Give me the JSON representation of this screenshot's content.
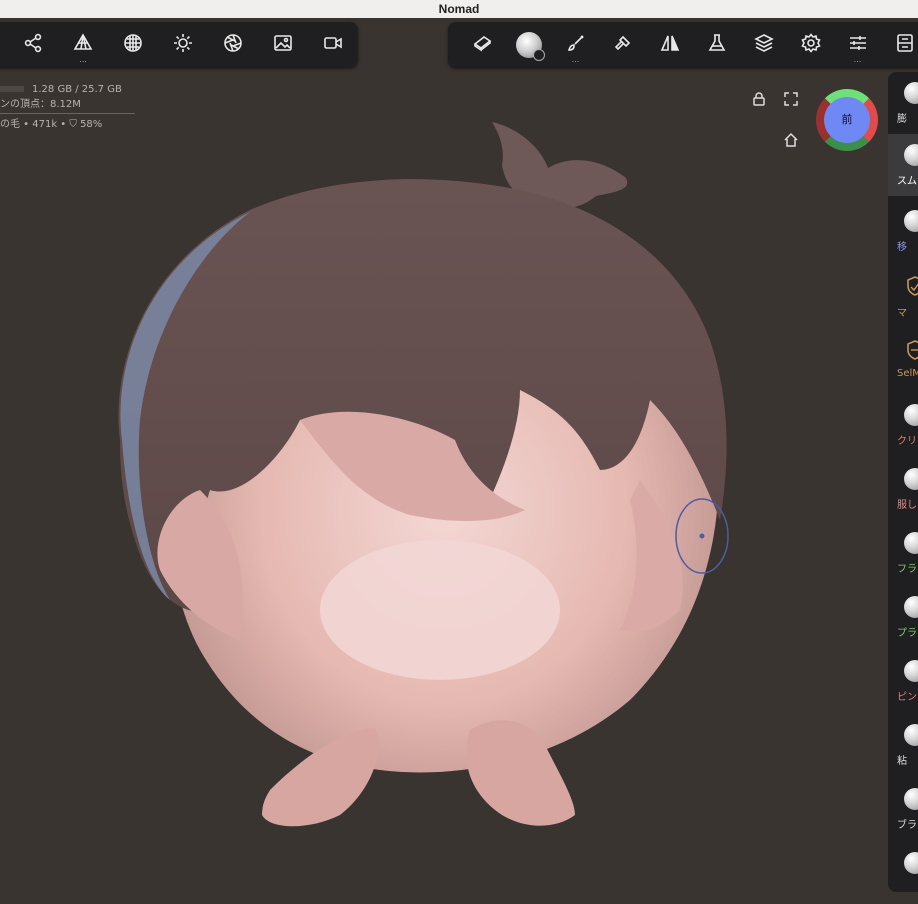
{
  "window": {
    "title": "Nomad"
  },
  "toolbar_left": [
    {
      "name": "scene-icon",
      "dots": ""
    },
    {
      "name": "topology-icon",
      "dots": "..."
    },
    {
      "name": "material-sphere-icon",
      "dots": ""
    },
    {
      "name": "light-icon",
      "dots": ""
    },
    {
      "name": "postprocess-icon",
      "dots": ""
    },
    {
      "name": "background-image-icon",
      "dots": ""
    },
    {
      "name": "camera-icon",
      "dots": ""
    }
  ],
  "toolbar_right": [
    {
      "name": "eraser-icon",
      "dots": ""
    },
    {
      "name": "brush-alpha-icon",
      "dots": ""
    },
    {
      "name": "paint-brush-icon",
      "dots": "..."
    },
    {
      "name": "hammer-icon",
      "dots": ""
    },
    {
      "name": "symmetry-icon",
      "dots": ""
    },
    {
      "name": "flask-icon",
      "dots": ""
    },
    {
      "name": "layers-icon",
      "dots": ""
    },
    {
      "name": "settings-gear-icon",
      "dots": ""
    },
    {
      "name": "sliders-icon",
      "dots": "..."
    },
    {
      "name": "file-icon",
      "dots": ""
    }
  ],
  "stats": {
    "memory": "1.28 GB / 25.7 GB",
    "vertices": "ンの頂点：8.12M",
    "object": "の毛 • 471k • ⛉ 58%"
  },
  "gizmo": {
    "front_label": "前"
  },
  "tools": [
    {
      "label": "膨",
      "color": "#dddddd",
      "icon": "ball"
    },
    {
      "label": "スム",
      "color": "#ffffff",
      "icon": "ball",
      "active": true
    },
    {
      "label": "移",
      "color": "#8f95e8",
      "icon": "ball"
    },
    {
      "label": "マ",
      "color": "#c8965a",
      "icon": "shield"
    },
    {
      "label": "SelM",
      "color": "#c8965a",
      "icon": "shield"
    },
    {
      "label": "クリ",
      "color": "#e77b6b",
      "icon": "ball"
    },
    {
      "label": "服し",
      "color": "#e08a8a",
      "icon": "ball"
    },
    {
      "label": "フラ",
      "color": "#7cd36a",
      "icon": "ball"
    },
    {
      "label": "プラ",
      "color": "#7cd36a",
      "icon": "ball"
    },
    {
      "label": "ピン",
      "color": "#e87d6d",
      "icon": "ball"
    },
    {
      "label": "粘",
      "color": "#dddddd",
      "icon": "ball"
    },
    {
      "label": "ブラ",
      "color": "#dddddd",
      "icon": "ball"
    },
    {
      "label": "",
      "color": "#dddddd",
      "icon": "ball"
    }
  ]
}
